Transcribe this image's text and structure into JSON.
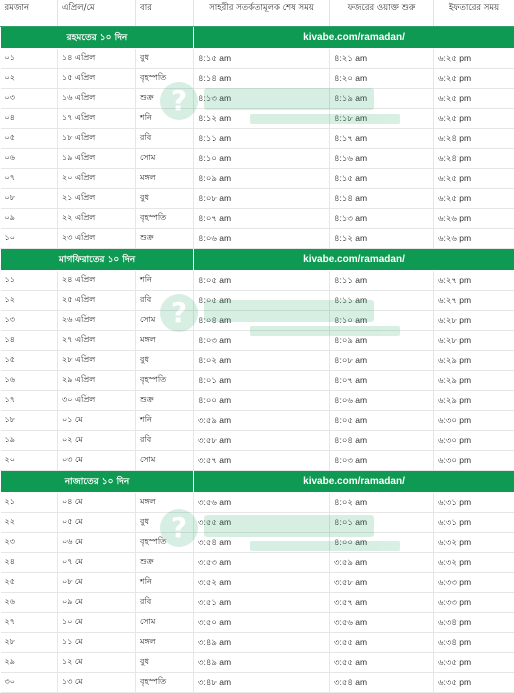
{
  "headers": [
    "রমজান",
    "এপ্রিল/মে",
    "বার",
    "সাহরীর সতর্কতামূলক শেষ সময়",
    "ফজরের ওয়াক্ত শুরু",
    "ইফতারের সময়"
  ],
  "sections": [
    {
      "title": "রহমতের ১০ দিন",
      "link": "kivabe.com/ramadan/",
      "rows": [
        [
          "০১",
          "১৪ এপ্রিল",
          "বুধ",
          "৪:১৫ am",
          "৪:২১ am",
          "৬:২৫ pm"
        ],
        [
          "০২",
          "১৫ এপ্রিল",
          "বৃহস্পতি",
          "৪:১৪ am",
          "৪:২০ am",
          "৬:২৫ pm"
        ],
        [
          "০৩",
          "১৬ এপ্রিল",
          "শুক্র",
          "৪:১৩ am",
          "৪:১৯ am",
          "৬:২৫ pm"
        ],
        [
          "০৪",
          "১৭ এপ্রিল",
          "শনি",
          "৪:১২ am",
          "৪:১৮ am",
          "৬:২৫ pm"
        ],
        [
          "০৫",
          "১৮ এপ্রিল",
          "রবি",
          "৪:১১ am",
          "৪:১৭ am",
          "৬:২৪ pm"
        ],
        [
          "০৬",
          "১৯ এপ্রিল",
          "সোম",
          "৪:১০ am",
          "৪:১৬ am",
          "৬:২৪ pm"
        ],
        [
          "০৭",
          "২০ এপ্রিল",
          "মঙ্গল",
          "৪:০৯ am",
          "৪:১৫ am",
          "৬:২৫ pm"
        ],
        [
          "০৮",
          "২১ এপ্রিল",
          "বুধ",
          "৪:০৮ am",
          "৪:১৪ am",
          "৬:২৫ pm"
        ],
        [
          "০৯",
          "২২ এপ্রিল",
          "বৃহস্পতি",
          "৪:০৭ am",
          "৪:১৩ am",
          "৬:২৬ pm"
        ],
        [
          "১০",
          "২৩ এপ্রিল",
          "শুক্র",
          "৪:০৬ am",
          "৪:১২ am",
          "৬:২৬ pm"
        ]
      ]
    },
    {
      "title": "মাগফিরাতের ১০ দিন",
      "link": "kivabe.com/ramadan/",
      "rows": [
        [
          "১১",
          "২৪ এপ্রিল",
          "শনি",
          "৪:০৫ am",
          "৪:১১ am",
          "৬:২৭ pm"
        ],
        [
          "১২",
          "২৫ এপ্রিল",
          "রবি",
          "৪:০৫ am",
          "৪:১১ am",
          "৬:২৭ pm"
        ],
        [
          "১৩",
          "২৬ এপ্রিল",
          "সোম",
          "৪:০৪ am",
          "৪:১০ am",
          "৬:২৮ pm"
        ],
        [
          "১৪",
          "২৭ এপ্রিল",
          "মঙ্গল",
          "৪:০৩ am",
          "৪:০৯ am",
          "৬:২৮ pm"
        ],
        [
          "১৫",
          "২৮ এপ্রিল",
          "বুধ",
          "৪:০২ am",
          "৪:০৮ am",
          "৬:২৯ pm"
        ],
        [
          "১৬",
          "২৯ এপ্রিল",
          "বৃহস্পতি",
          "৪:০১ am",
          "৪:০৭ am",
          "৬:২৯ pm"
        ],
        [
          "১৭",
          "৩০ এপ্রিল",
          "শুক্র",
          "৪:০০ am",
          "৪:০৬ am",
          "৬:২৯ pm"
        ],
        [
          "১৮",
          "০১ মে",
          "শনি",
          "৩:৫৯ am",
          "৪:০৫ am",
          "৬:৩০ pm"
        ],
        [
          "১৯",
          "০২ মে",
          "রবি",
          "৩:৫৮ am",
          "৪:০৪ am",
          "৬:৩০ pm"
        ],
        [
          "২০",
          "০৩ মে",
          "সোম",
          "৩:৫৭ am",
          "৪:০৩ am",
          "৬:৩০ pm"
        ]
      ]
    },
    {
      "title": "নাজাতের ১০ দিন",
      "link": "kivabe.com/ramadan/",
      "rows": [
        [
          "২১",
          "০৪ মে",
          "মঙ্গল",
          "৩:৫৬ am",
          "৪:০২ am",
          "৬:৩১ pm"
        ],
        [
          "২২",
          "০৫ মে",
          "বুধ",
          "৩:৫৫ am",
          "৪:০১ am",
          "৬:৩১ pm"
        ],
        [
          "২৩",
          "০৬ মে",
          "বৃহস্পতি",
          "৩:৫৪ am",
          "৪:০০ am",
          "৬:৩২ pm"
        ],
        [
          "২৪",
          "০৭ মে",
          "শুক্র",
          "৩:৫৩ am",
          "৩:৫৯ am",
          "৬:৩২ pm"
        ],
        [
          "২৫",
          "০৮ মে",
          "শনি",
          "৩:৫২ am",
          "৩:৫৮ am",
          "৬:৩৩ pm"
        ],
        [
          "২৬",
          "০৯ মে",
          "রবি",
          "৩:৫১ am",
          "৩:৫৭ am",
          "৬:৩৩ pm"
        ],
        [
          "২৭",
          "১০ মে",
          "সোম",
          "৩:৫০ am",
          "৩:৫৬ am",
          "৬:৩৪ pm"
        ],
        [
          "২৮",
          "১১ মে",
          "মঙ্গল",
          "৩:৪৯ am",
          "৩:৫৫ am",
          "৬:৩৪ pm"
        ],
        [
          "২৯",
          "১২ মে",
          "বুধ",
          "৩:৪৯ am",
          "৩:৫৫ am",
          "৬:৩৫ pm"
        ],
        [
          "৩০",
          "১৩ মে",
          "বৃহস্পতি",
          "৩:৪৮ am",
          "৩:৫৪ am",
          "৬:৩৫ pm"
        ]
      ]
    }
  ],
  "watermark": {
    "text": "কিভাবে.কম",
    "tagline": "জানতে ও জানাতে আসুন",
    "icon": "question-mark-logo-icon",
    "color": "#0e9a52"
  },
  "colors": {
    "section_bg": "#0e9a52",
    "header_rule": "#2fa36b"
  }
}
